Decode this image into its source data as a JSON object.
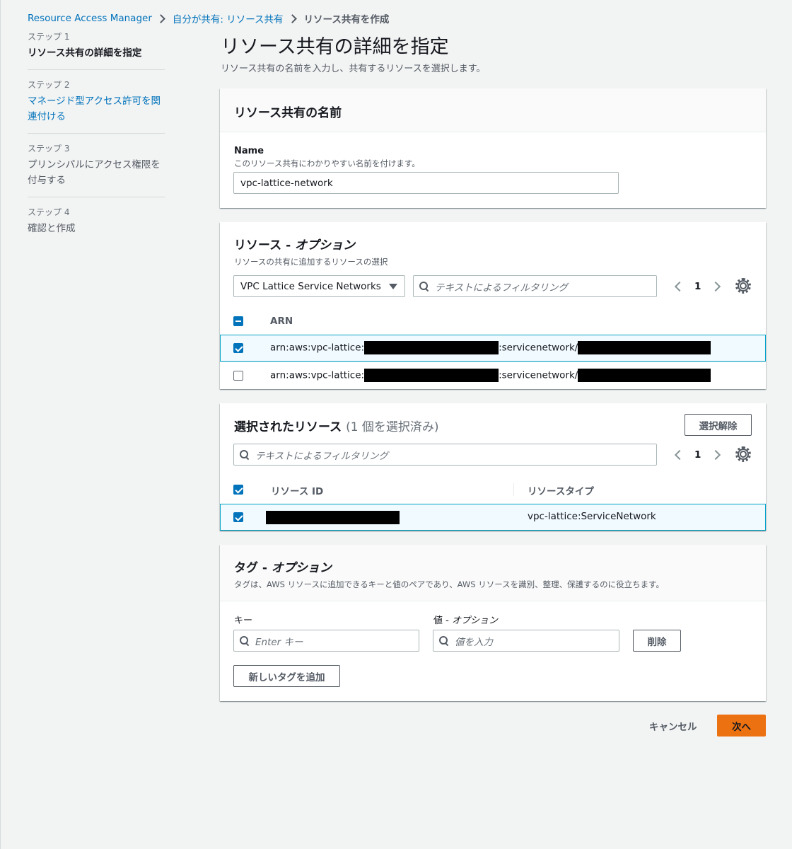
{
  "breadcrumb": {
    "items": [
      "Resource Access Manager",
      "自分が共有: リソース共有",
      "リソース共有を作成"
    ]
  },
  "steps": [
    {
      "num": "ステップ 1",
      "title": "リソース共有の詳細を指定",
      "state": "active"
    },
    {
      "num": "ステップ 2",
      "title": "マネージド型アクセス許可を関連付ける",
      "state": "link"
    },
    {
      "num": "ステップ 3",
      "title": "プリンシパルにアクセス権限を付与する",
      "state": "muted"
    },
    {
      "num": "ステップ 4",
      "title": "確認と作成",
      "state": "muted"
    }
  ],
  "header": {
    "title": "リソース共有の詳細を指定",
    "description": "リソース共有の名前を入力し、共有するリソースを選択します。"
  },
  "name_section": {
    "title": "リソース共有の名前",
    "field_label": "Name",
    "field_desc": "このリソース共有にわかりやすい名前を付けます。",
    "value": "vpc-lattice-network"
  },
  "resources_section": {
    "title_main": "リソース - ",
    "title_opt": "オプション",
    "subtitle": "リソースの共有に追加するリソースの選択",
    "type_select": "VPC Lattice Service Networks",
    "filter_placeholder": "テキストによるフィルタリング",
    "page": "1",
    "column_arn": "ARN",
    "rows": [
      {
        "arn_prefix": "arn:aws:vpc-lattice:",
        "arn_mid": ":servicenetwork/",
        "checked": true
      },
      {
        "arn_prefix": "arn:aws:vpc-lattice:",
        "arn_mid": ":servicenetwork/",
        "checked": false
      }
    ]
  },
  "selected_section": {
    "title": "選択されたリソース",
    "count": "(1 個を選択済み)",
    "deselect_button": "選択解除",
    "filter_placeholder": "テキストによるフィルタリング",
    "page": "1",
    "column_id": "リソース ID",
    "column_type": "リソースタイプ",
    "rows": [
      {
        "type": "vpc-lattice:ServiceNetwork"
      }
    ]
  },
  "tags_section": {
    "title_main": "タグ - ",
    "title_opt": "オプション",
    "subtitle": "タグは、AWS リソースに追加できるキーと値のペアであり、AWS リソースを識別、整理、保護するのに役立ちます。",
    "key_label": "キー",
    "key_placeholder": "Enter キー",
    "value_label_main": "値 - ",
    "value_label_opt": "オプション",
    "value_placeholder": "値を入力",
    "delete_button": "削除",
    "add_button": "新しいタグを追加"
  },
  "footer": {
    "cancel": "キャンセル",
    "next": "次へ"
  },
  "colors": {
    "link": "#0073bb",
    "primary": "#ec7211",
    "selected_row_bg": "#f1faff",
    "selected_row_border": "#00a1c9"
  }
}
